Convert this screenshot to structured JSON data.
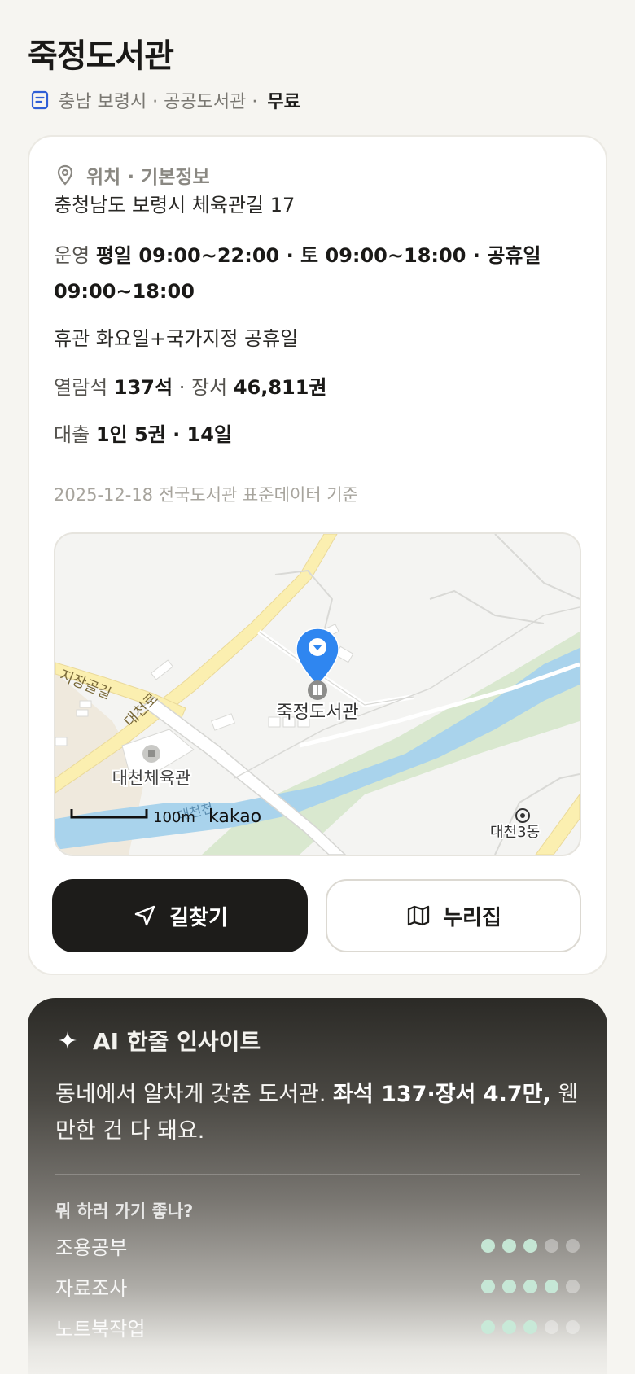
{
  "header": {
    "title": "죽정도서관",
    "subtitle_meta": "충남 보령시 · 공공도서관 ·",
    "price": "무료"
  },
  "info": {
    "section_title": "위치 · 기본정보",
    "address": "충청남도 보령시 체육관길 17",
    "hours_label": "운영",
    "hours_value": "평일 09:00~22:00 · 토 09:00~18:00 · 공휴일 09:00~18:00",
    "closed": "휴관 화요일+국가지정 공휴일",
    "seats_label": "열람석",
    "seats_value": "137석",
    "books_label": "장서",
    "books_value": "46,811권",
    "loan_label": "대출",
    "loan_value": "1인 5권 · 14일",
    "source": "2025-12-18 전국도서관 표준데이터 기준"
  },
  "map": {
    "marker_label": "죽정도서관",
    "gym_label": "대천체육관",
    "road_label": "대천로",
    "street_label": "지장골길",
    "stream_label": "대천천",
    "district_label": "대천3동",
    "scale_label": "100m",
    "provider": "kakao"
  },
  "actions": {
    "directions": "길찾기",
    "nurizip": "누리집"
  },
  "ai": {
    "title": "AI 한줄 인사이트",
    "text_plain": "동네에서 알차게 갖춘 도서관.",
    "text_bold": "좌석 137·장서 4.7만,",
    "text_tail": "웬만한 건 다 돼요.",
    "question": "뭐 하러 가기 좋나?",
    "scores": [
      {
        "label": "조용공부",
        "score": 3,
        "max": 5
      },
      {
        "label": "자료조사",
        "score": 4,
        "max": 5
      },
      {
        "label": "노트북작업",
        "score": 3,
        "max": 5
      }
    ]
  },
  "colors": {
    "primary_button": "#1d1c1a",
    "map_pin": "#2f86f0",
    "score_dot": "#c7ead8"
  }
}
